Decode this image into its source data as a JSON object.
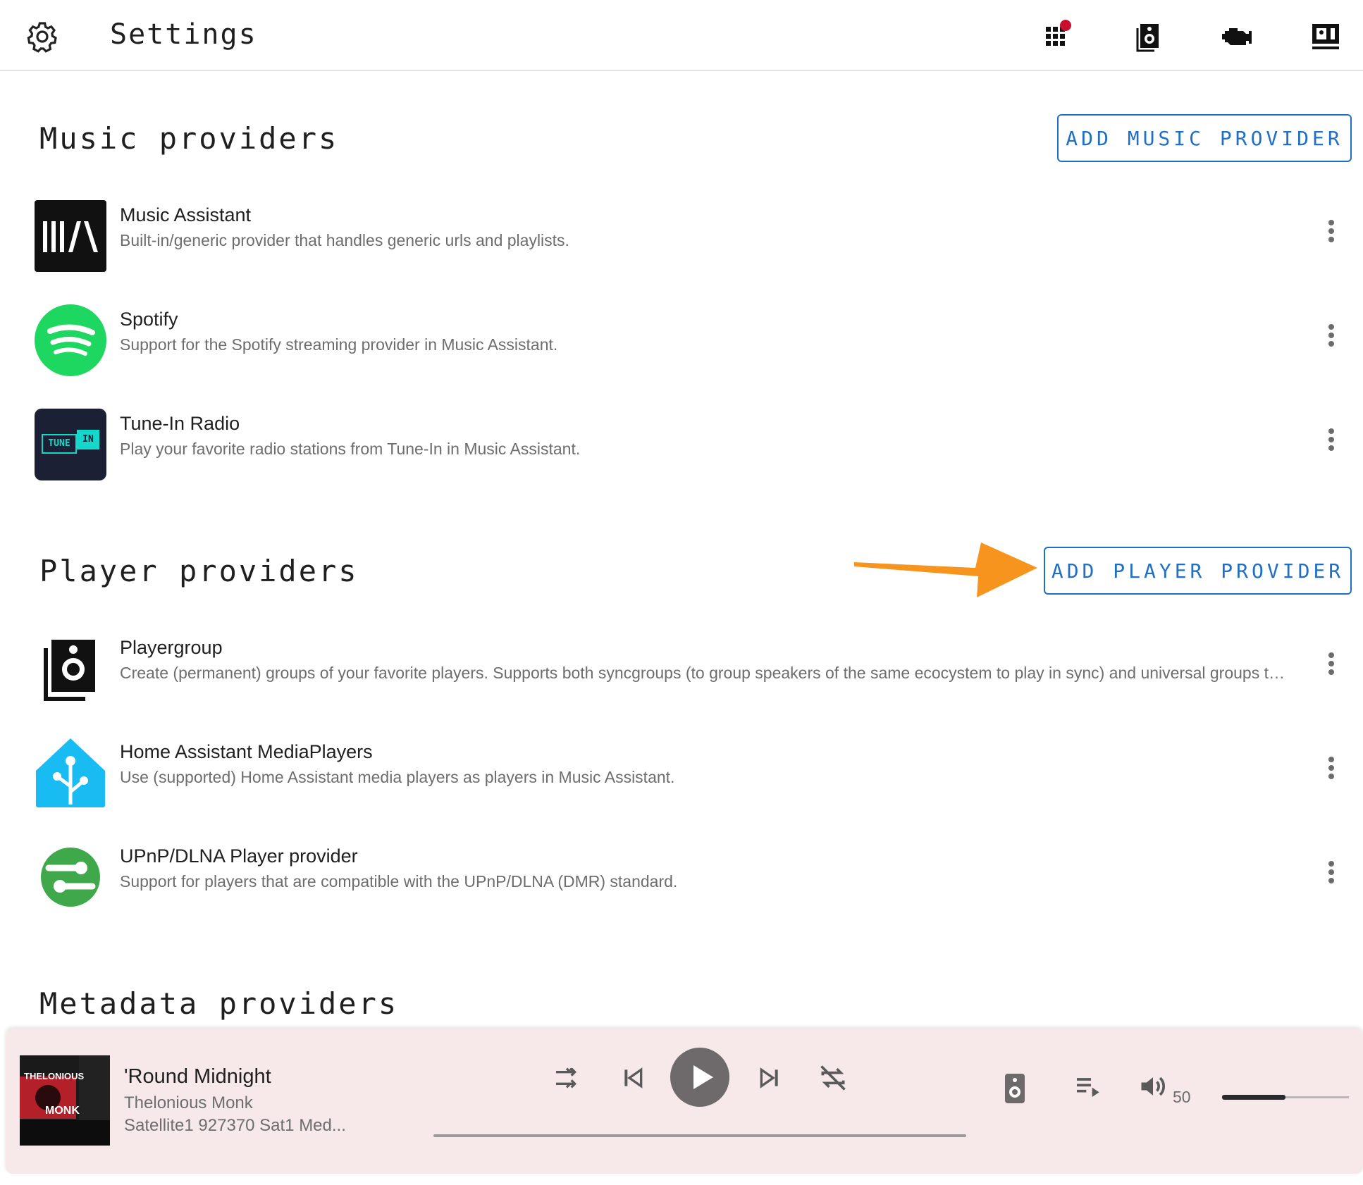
{
  "header": {
    "title": "Settings",
    "icons": [
      "gear-icon",
      "apps-icon",
      "speaker-icon",
      "engine-icon",
      "display-icon"
    ],
    "notification_color": "#c8102e"
  },
  "music_section": {
    "title": "Music providers",
    "add_label": "ADD MUSIC PROVIDER",
    "items": [
      {
        "name": "Music Assistant",
        "desc": "Built-in/generic provider that handles generic urls and playlists.",
        "logo_text": "III/\\"
      },
      {
        "name": "Spotify",
        "desc": "Support for the Spotify streaming provider in Music Assistant."
      },
      {
        "name": "Tune-In Radio",
        "desc": "Play your favorite radio stations from Tune-In in Music Assistant.",
        "logo_text_a": "TUNE",
        "logo_text_b": "IN"
      }
    ]
  },
  "player_section": {
    "title": "Player providers",
    "add_label": "ADD PLAYER PROVIDER",
    "items": [
      {
        "name": "Playergroup",
        "desc": "Create (permanent) groups of your favorite players. Supports both syncgroups (to group speakers of the same ecocystem to play in sync) and universal groups to group speakers of different ecosystems to play the same audio."
      },
      {
        "name": "Home Assistant MediaPlayers",
        "desc": "Use (supported) Home Assistant media players as players in Music Assistant."
      },
      {
        "name": "UPnP/DLNA Player provider",
        "desc": "Support for players that are compatible with the UPnP/DLNA (DMR) standard."
      }
    ]
  },
  "metadata_section": {
    "title": "Metadata providers"
  },
  "player": {
    "track": "'Round Midnight",
    "artist": "Thelonious Monk",
    "source": "Satellite1 927370 Sat1 Med...",
    "cover_text_a": "THELONIOUS",
    "cover_text_b": "MONK",
    "volume": "50",
    "volume_fraction": 0.5
  },
  "colors": {
    "accent": "#1f6fc4",
    "arrow": "#f7941d",
    "spotify": "#1ed760",
    "tunein_bg": "#1c2034",
    "tunein_accent": "#14d8cc",
    "ha_blue": "#18bcf2",
    "upnp_green": "#3fa84a",
    "player_bg": "#f7e9ea"
  }
}
